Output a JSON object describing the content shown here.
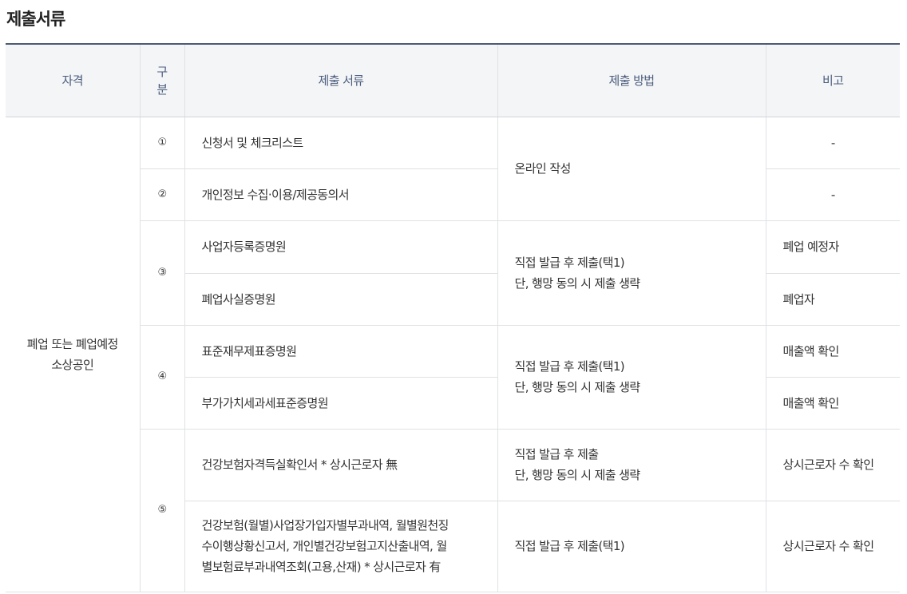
{
  "page": {
    "title": "제출서류"
  },
  "table": {
    "headers": {
      "qualification": "자격",
      "gubun_1": "구",
      "gubun_2": "분",
      "documents": "제출 서류",
      "method": "제출 방법",
      "remarks": "비고"
    },
    "qualification_line1": "폐업 또는 폐업예정",
    "qualification_line2": "소상공인",
    "groups": [
      {
        "number": "①"
      },
      {
        "number": "②"
      },
      {
        "number": "③"
      },
      {
        "number": "④"
      },
      {
        "number": "⑤"
      }
    ],
    "rows": [
      {
        "document": "신청서 및 체크리스트",
        "remark": "-"
      },
      {
        "document": "개인정보 수집·이용/제공동의서",
        "remark": "-"
      },
      {
        "document": "사업자등록증명원",
        "remark": "폐업 예정자"
      },
      {
        "document": "폐업사실증명원",
        "remark": "폐업자"
      },
      {
        "document": "표준재무제표증명원",
        "remark": "매출액 확인"
      },
      {
        "document": "부가가치세과세표준증명원",
        "remark": "매출액 확인"
      },
      {
        "document": "건강보험자격득실확인서 * 상시근로자 無",
        "remark": "상시근로자 수 확인"
      },
      {
        "doc_line1": "건강보험(월별)사업장가입자별부과내역, 월별원천징",
        "doc_line2": "수이행상황신고서, 개인별건강보험고지산출내역, 월",
        "doc_line3": "별보험료부과내역조회(고용,산재) * 상시근로자 有",
        "remark": "상시근로자 수 확인"
      }
    ],
    "methods": {
      "online": "온라인 작성",
      "direct_a_line1": "직접 발급 후 제출(택1)",
      "direct_a_line2": "단, 행망 동의 시 제출 생략",
      "direct_b_line1": "직접 발급 후 제출(택1)",
      "direct_b_line2": "단, 행망 동의 시 제출 생략",
      "direct_c_line1": "직접 발급 후 제출",
      "direct_c_line2": "단, 행망 동의 시 제출 생략",
      "direct_d": "직접 발급 후 제출(택1)"
    }
  }
}
